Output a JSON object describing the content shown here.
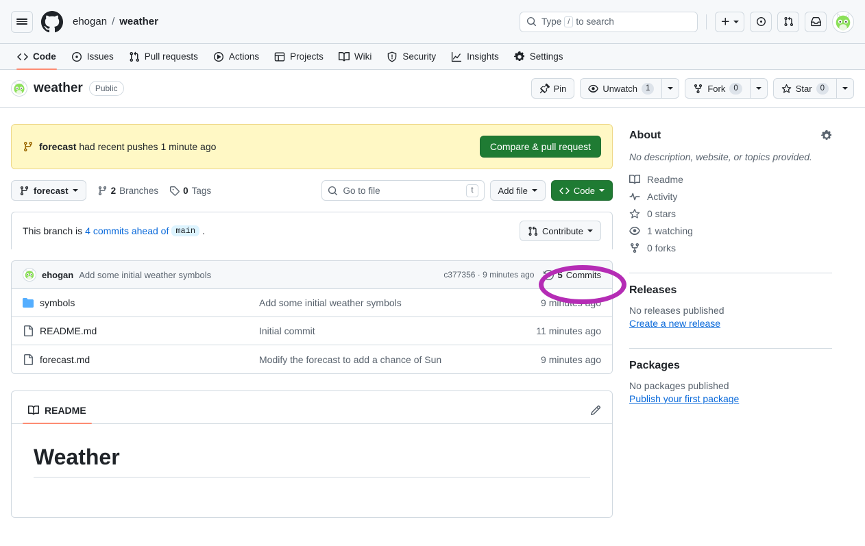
{
  "header": {
    "hamburger_label": "Open global navigation menu",
    "logo_name": "github-logo",
    "owner": "ehogan",
    "separator": "/",
    "repo": "weather",
    "search_placeholder_pre": "Type",
    "search_key": "/",
    "search_placeholder_post": "to search",
    "create_new_label": "+",
    "issues_icon_label": "issues",
    "pull_requests_icon_label": "pull-requests",
    "inbox_icon_label": "notifications",
    "avatar_label": "ehogan"
  },
  "nav_tabs": [
    {
      "label": "Code",
      "icon": "code-icon",
      "active": true
    },
    {
      "label": "Issues",
      "icon": "issue-opened-icon",
      "active": false
    },
    {
      "label": "Pull requests",
      "icon": "git-pull-request-icon",
      "active": false
    },
    {
      "label": "Actions",
      "icon": "play-icon",
      "active": false
    },
    {
      "label": "Projects",
      "icon": "table-icon",
      "active": false
    },
    {
      "label": "Wiki",
      "icon": "book-icon",
      "active": false
    },
    {
      "label": "Security",
      "icon": "shield-icon",
      "active": false
    },
    {
      "label": "Insights",
      "icon": "graph-icon",
      "active": false
    },
    {
      "label": "Settings",
      "icon": "gear-icon",
      "active": false
    }
  ],
  "repo_title": {
    "name": "weather",
    "visibility": "Public",
    "pin_label": "Pin",
    "watch_label": "Unwatch",
    "watch_count": "1",
    "fork_label": "Fork",
    "fork_count": "0",
    "star_label": "Star",
    "star_count": "0"
  },
  "push_banner": {
    "branch": "forecast",
    "message": " had recent pushes 1 minute ago",
    "button_label": "Compare & pull request"
  },
  "file_nav": {
    "branch": "forecast",
    "branches_count": "2",
    "branches_label": "Branches",
    "tags_count": "0",
    "tags_label": "Tags",
    "goto_file_placeholder": "Go to file",
    "goto_file_key": "t",
    "add_file_label": "Add file",
    "code_label": "Code"
  },
  "ahead_notice": {
    "prefix": "This branch is ",
    "link": "4 commits ahead of",
    "base_branch": "main",
    "suffix": ".",
    "contribute_label": "Contribute"
  },
  "latest_commit": {
    "author": "ehogan",
    "message": "Add some initial weather symbols",
    "hash": "c377356",
    "separator": " · ",
    "time": "9 minutes ago",
    "commits_count": "5",
    "commits_label": "Commits"
  },
  "files": [
    {
      "name": "symbols",
      "type": "directory",
      "commit": "Add some initial weather symbols",
      "time": "9 minutes ago"
    },
    {
      "name": "README.md",
      "type": "file",
      "commit": "Initial commit",
      "time": "11 minutes ago"
    },
    {
      "name": "forecast.md",
      "type": "file",
      "commit": "Modify the forecast to add a chance of Sun",
      "time": "9 minutes ago"
    }
  ],
  "readme": {
    "tab_label": "README",
    "edit_label": "Edit README",
    "heading": "Weather"
  },
  "sidebar": {
    "about_title": "About",
    "about_description": "No description, website, or topics provided.",
    "links": [
      {
        "label": "Readme",
        "icon": "book-icon"
      },
      {
        "label": "Activity",
        "icon": "pulse-icon"
      },
      {
        "label": "0 stars",
        "icon": "star-icon"
      },
      {
        "label": "1 watching",
        "icon": "eye-icon"
      },
      {
        "label": "0 forks",
        "icon": "fork-icon"
      }
    ],
    "releases_title": "Releases",
    "releases_empty": "No releases published",
    "releases_link": "Create a new release",
    "packages_title": "Packages",
    "packages_empty": "No packages published",
    "packages_link": "Publish your first package"
  },
  "annotation": {
    "shape": "ellipse",
    "color": "#b52cb5",
    "targets": "5 Commits"
  },
  "colors": {
    "accent_green": "#1f7b33",
    "link_blue": "#0969da",
    "banner_yellow": "#fff8c5",
    "tab_underline": "#fd8c73",
    "annotation_purple": "#b52cb5"
  }
}
